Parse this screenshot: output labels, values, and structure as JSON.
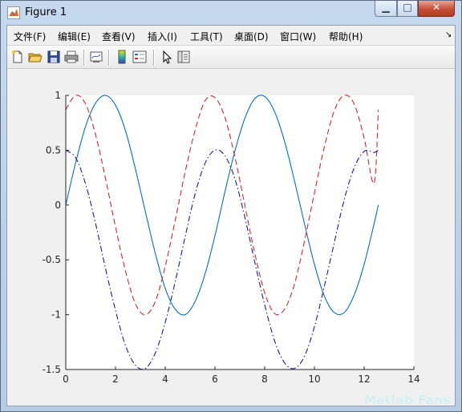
{
  "window": {
    "title": "Figure 1"
  },
  "window_controls": {
    "minimize": "▁",
    "maximize": "□",
    "close": "✕"
  },
  "menu": {
    "items": [
      "文件(F)",
      "编辑(E)",
      "查看(V)",
      "插入(I)",
      "工具(T)",
      "桌面(D)",
      "窗口(W)",
      "帮助(H)"
    ],
    "overflow": "↘"
  },
  "toolbar": {
    "icons": [
      "new-figure-icon",
      "open-file-icon",
      "save-icon",
      "print-icon",
      "link-plot-icon",
      "colorbar-icon",
      "legend-icon",
      "edit-pointer-icon",
      "property-inspector-icon"
    ]
  },
  "watermark": "Matlab Fans",
  "chart_data": {
    "type": "line",
    "xlim": [
      0,
      14
    ],
    "ylim": [
      -1.5,
      1
    ],
    "x_ticks": [
      "0",
      "2",
      "4",
      "6",
      "8",
      "10",
      "12",
      "14"
    ],
    "y_ticks": [
      "1",
      "0.5",
      "0",
      "-0.5",
      "-1",
      "-1.5"
    ],
    "grid": false,
    "x": [
      0,
      0.4,
      0.8,
      1.2,
      1.6,
      2.0,
      2.4,
      2.8,
      3.2,
      3.6,
      4.0,
      4.4,
      4.8,
      5.2,
      5.6,
      6.0,
      6.4,
      6.8,
      7.2,
      7.6,
      8.0,
      8.4,
      8.8,
      9.2,
      9.6,
      10.0,
      10.4,
      10.8,
      11.2,
      11.6,
      12.0,
      12.4,
      12.57
    ],
    "series": [
      {
        "style": "solid",
        "color": "#0072bd",
        "values": [
          0,
          0.39,
          0.72,
          0.93,
          1.0,
          0.91,
          0.68,
          0.33,
          -0.06,
          -0.44,
          -0.76,
          -0.95,
          -1.0,
          -0.88,
          -0.63,
          -0.28,
          0.12,
          0.49,
          0.79,
          0.97,
          0.99,
          0.85,
          0.58,
          0.22,
          -0.17,
          -0.54,
          -0.83,
          -0.98,
          -0.98,
          -0.82,
          -0.54,
          -0.17,
          0
        ]
      },
      {
        "style": "dashed",
        "color": "#d62728",
        "values": [
          0.87,
          1.0,
          0.92,
          0.64,
          0.24,
          -0.2,
          -0.6,
          -0.9,
          -1.0,
          -0.88,
          -0.56,
          -0.14,
          0.3,
          0.68,
          0.95,
          0.98,
          0.8,
          0.44,
          0.0,
          -0.44,
          -0.8,
          -0.99,
          -0.95,
          -0.72,
          -0.33,
          0.11,
          0.53,
          0.86,
          1.0,
          0.92,
          0.61,
          0.2,
          0.87
        ]
      },
      {
        "style": "dashdot",
        "color": "#1a1aaa",
        "values": [
          0.5,
          0.43,
          0.19,
          -0.17,
          -0.58,
          -0.96,
          -1.28,
          -1.46,
          -1.49,
          -1.35,
          -1.07,
          -0.7,
          -0.29,
          0.1,
          0.38,
          0.5,
          0.45,
          0.24,
          -0.11,
          -0.52,
          -0.91,
          -1.24,
          -1.44,
          -1.49,
          -1.38,
          -1.11,
          -0.74,
          -0.34,
          0.05,
          0.34,
          0.49,
          0.48,
          0.5
        ]
      }
    ]
  }
}
